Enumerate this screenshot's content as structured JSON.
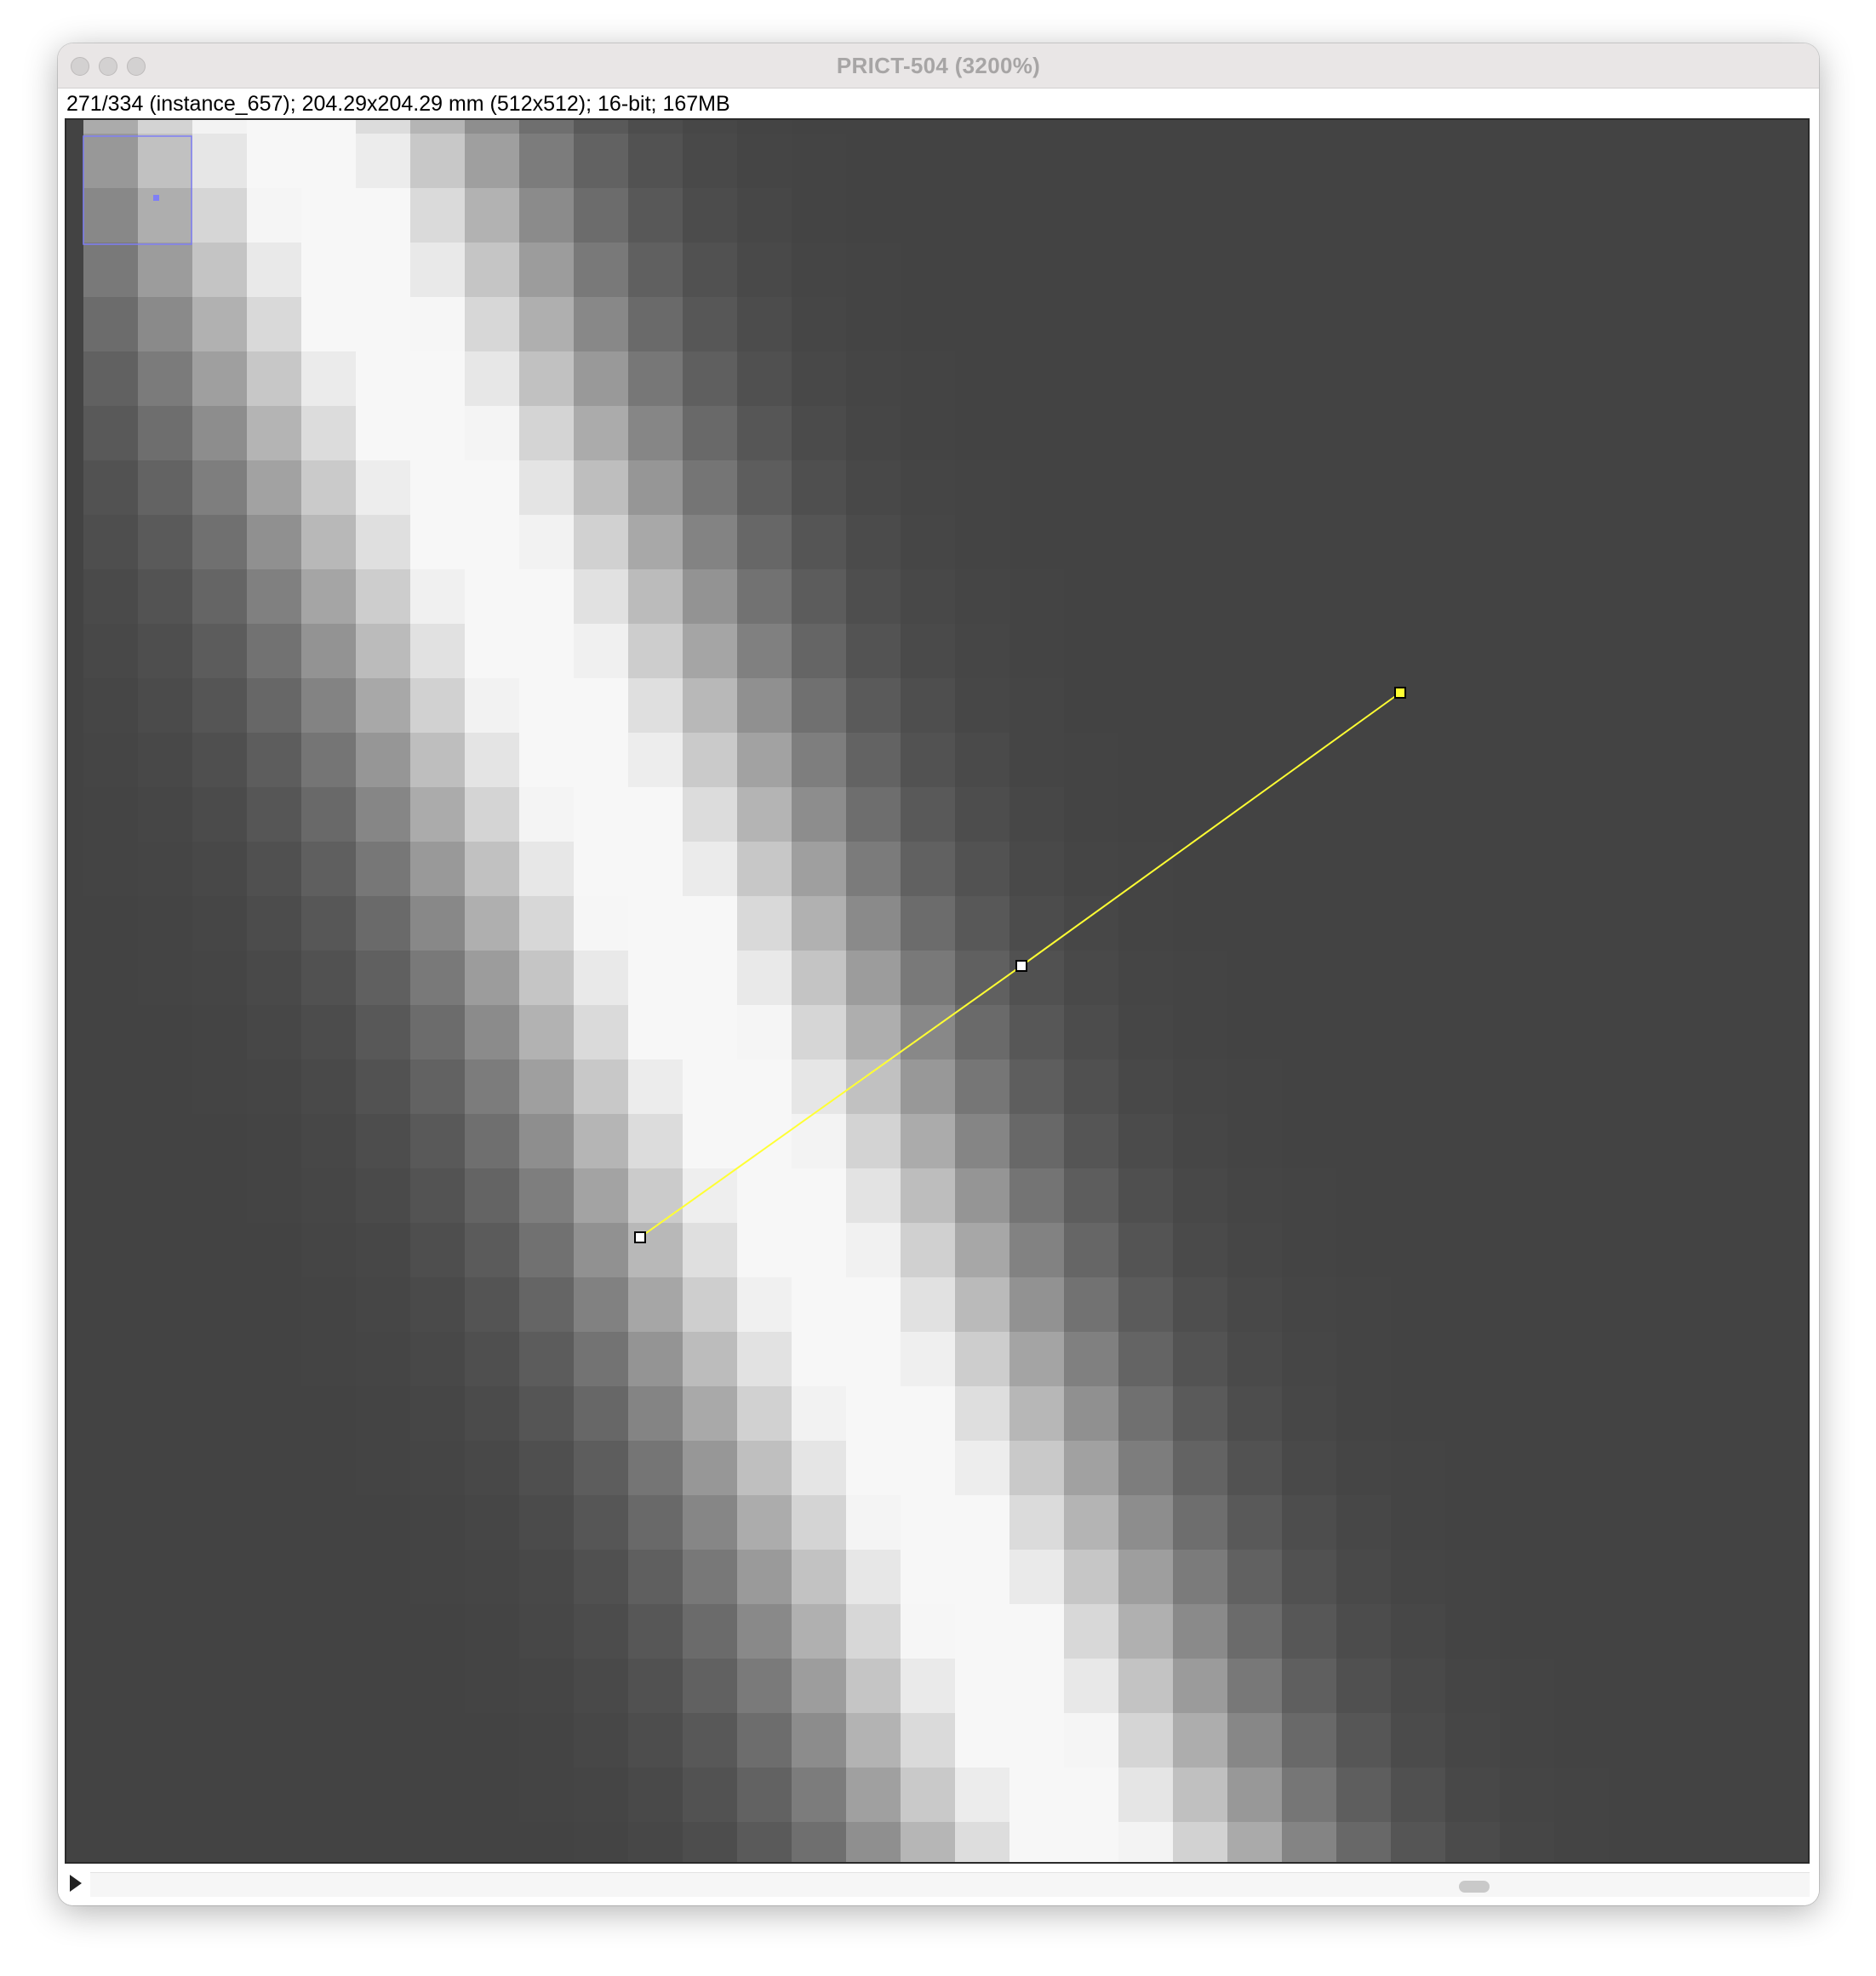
{
  "window": {
    "title": "PRICT-504 (3200%)",
    "info": "271/334 (instance_657); 204.29x204.29 mm (512x512); 16-bit; 167MB"
  },
  "colors": {
    "line_roi": "#ffff33",
    "navigator": "#7f7ff5",
    "background": "#434343"
  },
  "icons": {
    "play": "play-icon"
  }
}
